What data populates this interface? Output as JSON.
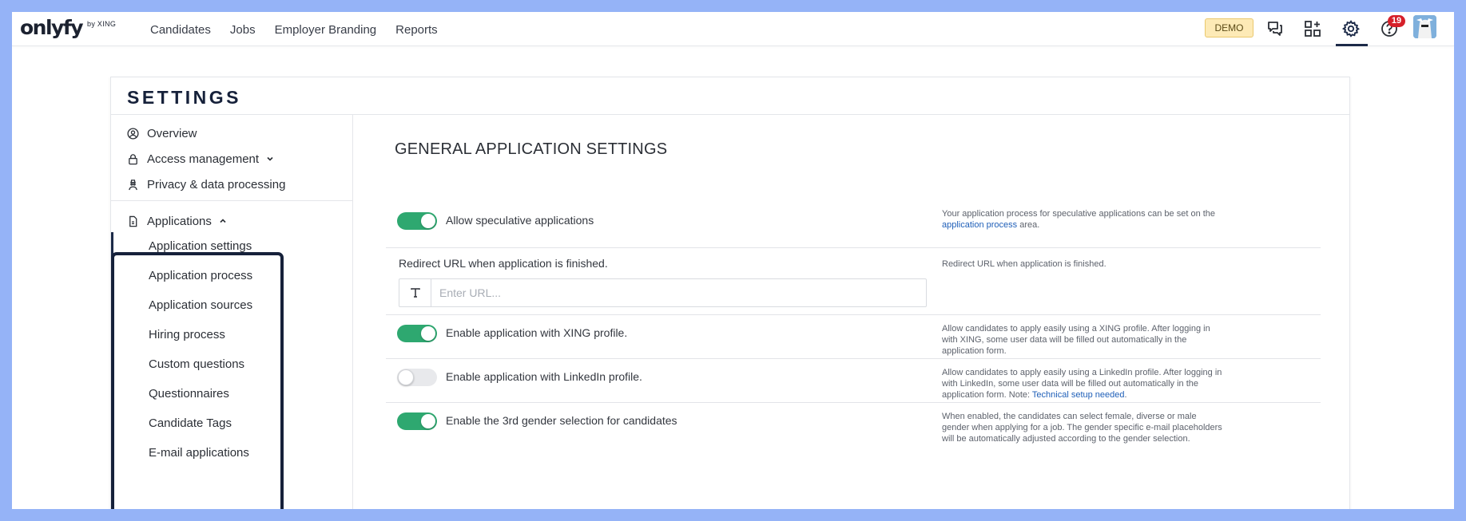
{
  "topnav": {
    "logo_main": "onlyfy",
    "logo_sub": "by XING",
    "links": [
      "Candidates",
      "Jobs",
      "Employer Branding",
      "Reports"
    ],
    "demo_badge": "DEMO",
    "notification_count": "19",
    "icons": [
      "chat-icon",
      "apps-add-icon",
      "gear-icon",
      "help-icon",
      "avatar"
    ]
  },
  "settings": {
    "title": "SETTINGS",
    "sidebar": {
      "overview": "Overview",
      "access_management": "Access management",
      "privacy": "Privacy & data processing",
      "applications": "Applications",
      "sub_items": [
        "Application settings",
        "Application process",
        "Application sources",
        "Hiring process",
        "Custom questions",
        "Questionnaires",
        "Candidate Tags",
        "E-mail applications"
      ]
    },
    "main": {
      "title": "GENERAL APPLICATION SETTINGS",
      "rows": {
        "speculative": {
          "label": "Allow speculative applications",
          "enabled": true,
          "help_before": "Your application process for speculative applications can be set on the ",
          "help_link": "application process",
          "help_after": " area."
        },
        "redirect": {
          "label": "Redirect URL when application is finished.",
          "placeholder": "Enter URL...",
          "value": "",
          "help": "Redirect URL when application is finished."
        },
        "xing": {
          "label": "Enable application with XING profile.",
          "enabled": true,
          "help": "Allow candidates to apply easily using a XING profile. After logging in with XING, some user data will be filled out automatically in the application form."
        },
        "linkedin": {
          "label": "Enable application with LinkedIn profile.",
          "enabled": false,
          "help_before": "Allow candidates to apply easily using a LinkedIn profile. After logging in with LinkedIn, some user data will be filled out automatically in the application form. Note: ",
          "help_link": "Technical setup needed",
          "help_after": "."
        },
        "gender": {
          "label": "Enable the 3rd gender selection for candidates",
          "enabled": true,
          "help": "When enabled, the candidates can select female, diverse or male gender when applying for a job. The gender specific e-mail placeholders will be automatically adjusted according to the gender selection."
        }
      }
    }
  },
  "colors": {
    "toggle_on": "#2ea870",
    "link": "#1f5fb8",
    "accent_dark": "#1c2a48",
    "frame": "#95b3f7"
  }
}
